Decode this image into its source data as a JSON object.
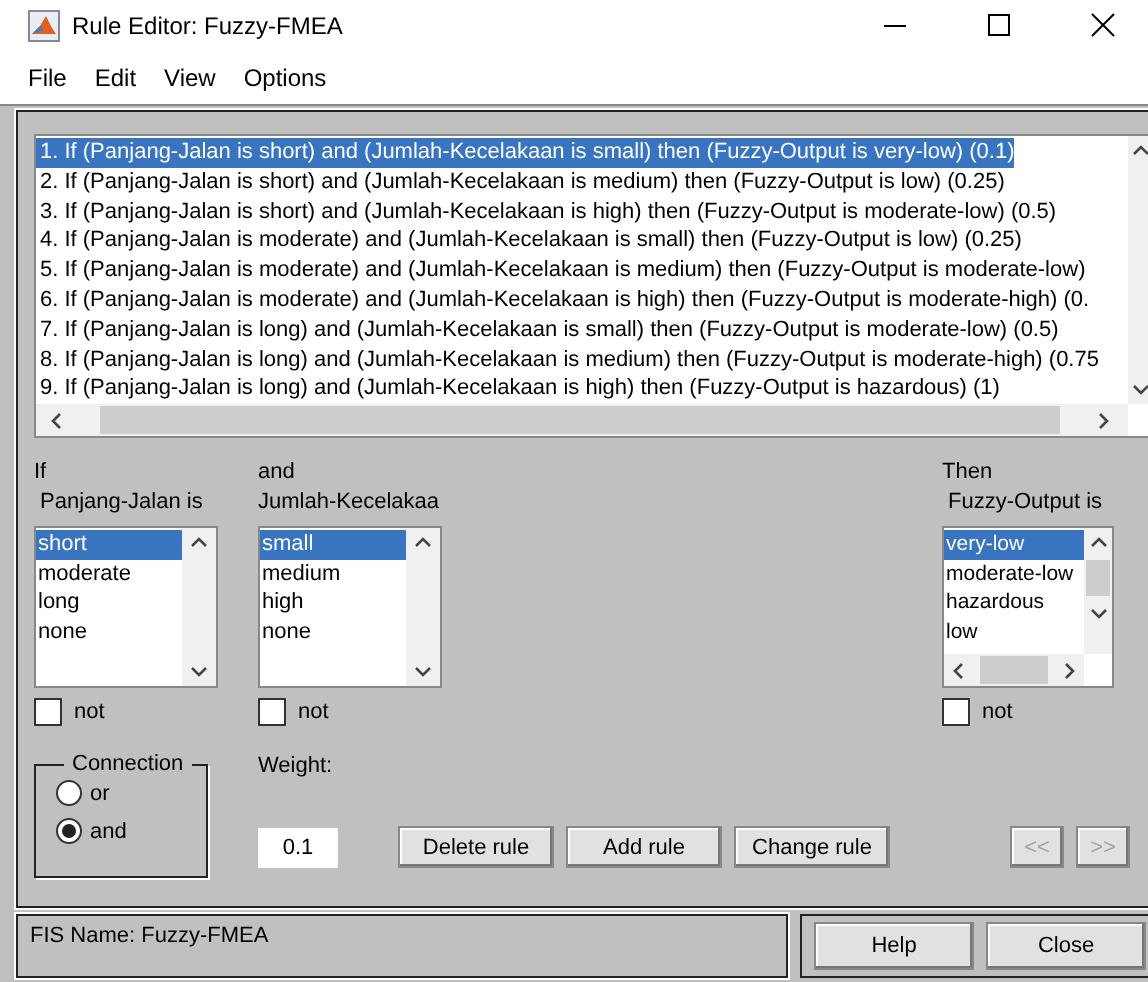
{
  "window": {
    "title": "Rule Editor: Fuzzy-FMEA"
  },
  "menu": [
    "File",
    "Edit",
    "View",
    "Options"
  ],
  "rules": [
    {
      "text": "1. If (Panjang-Jalan is short) and (Jumlah-Kecelakaan is small) then (Fuzzy-Output is very-low) (0.1)",
      "selected": true
    },
    {
      "text": "2. If (Panjang-Jalan is short) and (Jumlah-Kecelakaan is medium) then (Fuzzy-Output is low) (0.25)",
      "selected": false
    },
    {
      "text": "3. If (Panjang-Jalan is short) and (Jumlah-Kecelakaan is high) then (Fuzzy-Output is moderate-low) (0.5)",
      "selected": false
    },
    {
      "text": "4. If (Panjang-Jalan is moderate) and (Jumlah-Kecelakaan is small) then (Fuzzy-Output is low) (0.25)",
      "selected": false
    },
    {
      "text": "5. If (Panjang-Jalan is moderate) and (Jumlah-Kecelakaan is medium) then (Fuzzy-Output is moderate-low)",
      "selected": false
    },
    {
      "text": "6. If (Panjang-Jalan is moderate) and (Jumlah-Kecelakaan is high) then (Fuzzy-Output is moderate-high) (0.",
      "selected": false
    },
    {
      "text": "7. If (Panjang-Jalan is long) and (Jumlah-Kecelakaan is small) then (Fuzzy-Output is moderate-low) (0.5)",
      "selected": false
    },
    {
      "text": "8. If (Panjang-Jalan is long) and (Jumlah-Kecelakaan is medium) then (Fuzzy-Output is moderate-high) (0.75",
      "selected": false
    },
    {
      "text": "9. If (Panjang-Jalan is long) and (Jumlah-Kecelakaan is high) then (Fuzzy-Output is hazardous) (1)",
      "selected": false
    }
  ],
  "antecedents": [
    {
      "heading": "If",
      "variable": "Panjang-Jalan is",
      "items": [
        {
          "label": "short",
          "selected": true
        },
        {
          "label": "moderate",
          "selected": false
        },
        {
          "label": "long",
          "selected": false
        },
        {
          "label": "none",
          "selected": false
        }
      ],
      "not": {
        "label": "not",
        "checked": false
      }
    },
    {
      "heading": "and",
      "variable": "Jumlah-Kecelakaa",
      "items": [
        {
          "label": "small",
          "selected": true
        },
        {
          "label": "medium",
          "selected": false
        },
        {
          "label": "high",
          "selected": false
        },
        {
          "label": "none",
          "selected": false
        }
      ],
      "not": {
        "label": "not",
        "checked": false
      }
    }
  ],
  "consequent": {
    "heading": "Then",
    "variable": "Fuzzy-Output is",
    "items": [
      {
        "label": "very-low",
        "selected": true
      },
      {
        "label": "moderate-low",
        "selected": false
      },
      {
        "label": "hazardous",
        "selected": false
      },
      {
        "label": "low",
        "selected": false
      }
    ],
    "not": {
      "label": "not",
      "checked": false
    }
  },
  "connection": {
    "title": "Connection",
    "options": [
      {
        "label": "or",
        "selected": false
      },
      {
        "label": "and",
        "selected": true
      }
    ]
  },
  "weight": {
    "label": "Weight:",
    "value": "0.1"
  },
  "actions": [
    "Delete rule",
    "Add rule",
    "Change rule"
  ],
  "nav": [
    {
      "label": "<<",
      "disabled": true
    },
    {
      "label": ">>",
      "disabled": true
    }
  ],
  "status": "FIS Name: Fuzzy-FMEA",
  "footer_buttons": [
    "Help",
    "Close"
  ]
}
